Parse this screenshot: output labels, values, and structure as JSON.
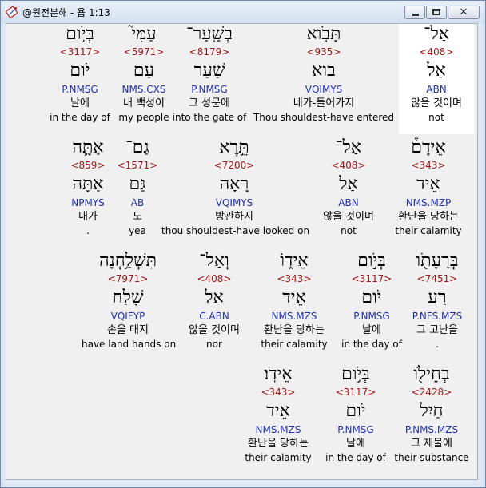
{
  "window": {
    "title": "@원전분해 - 욥 1:13",
    "icon": "bible-book-icon",
    "controls": {
      "minimize": "minimize-icon",
      "maximize": "maximize-icon",
      "close_glyph": "✕"
    }
  },
  "colors": {
    "strong": "#a01818",
    "parse": "#1f2fb0",
    "selected_bg": "#ffffff",
    "client_bg": "#f0f0f0"
  },
  "rows": [
    [
      {
        "hebrew": "אַל־",
        "strong": "<408>",
        "lemma": "אַל",
        "parse": "ABN",
        "korean": "않을 것이며",
        "english": "not",
        "selected": true
      },
      {
        "hebrew": "תָּבֹ֣וא",
        "strong": "<935>",
        "lemma": "בוא",
        "parse": "VQIMYS",
        "korean": "네가-들어가지",
        "english": "Thou shouldest-have entered"
      },
      {
        "hebrew": "בְשַֽׁעַר־",
        "strong": "<8179>",
        "lemma": "שַׁעַר",
        "parse": "P.NMSG",
        "korean": "그 성문에",
        "english": "into the gate of"
      },
      {
        "hebrew": "עַמִּי֮",
        "strong": "<5971>",
        "lemma": "עַם",
        "parse": "NMS.CXS",
        "korean": "내 백성이",
        "english": "my people"
      },
      {
        "hebrew": "בְּיֹ֣ום",
        "strong": "<3117>",
        "lemma": "יֹום",
        "parse": "P.NMSG",
        "korean": "날에",
        "english": "in the day of"
      }
    ],
    [
      {
        "hebrew": "אֵידָם֒",
        "strong": "<343>",
        "lemma": "אֵיד",
        "parse": "NMS.MZP",
        "korean": "환난을 당하는",
        "english": "their calamity"
      },
      {
        "hebrew": "אַל־",
        "strong": "<408>",
        "lemma": "אַל",
        "parse": "ABN",
        "korean": "않을 것이며",
        "english": "not"
      },
      {
        "hebrew": "תֵּ֣רֶא",
        "strong": "<7200>",
        "lemma": "רָאָה",
        "parse": "VQIMYS",
        "korean": "방관하지",
        "english": "thou shouldest-have looked on"
      },
      {
        "hebrew": "גַם־",
        "strong": "<1571>",
        "lemma": "גַּם",
        "parse": "AB",
        "korean": "도",
        "english": "yea"
      },
      {
        "hebrew": "אַתָּ֛ה",
        "strong": "<859>",
        "lemma": "אַתָּה",
        "parse": "NPMYS",
        "korean": "내가",
        "english": "."
      }
    ],
    [
      {
        "hebrew": "בְּרָעָתֹ֖ו",
        "strong": "<7451>",
        "lemma": "רַע",
        "parse": "P.NFS.MZS",
        "korean": "그 고난을",
        "english": "."
      },
      {
        "hebrew": "בְּיֹ֣ום",
        "strong": "<3117>",
        "lemma": "יֹום",
        "parse": "P.NMSG",
        "korean": "날에",
        "english": "in the day of"
      },
      {
        "hebrew": "אֵיד֑וֹ",
        "strong": "<343>",
        "lemma": "אֵיד",
        "parse": "NMS.MZS",
        "korean": "환난을 당하는",
        "english": "their calamity"
      },
      {
        "hebrew": "וְאַל־",
        "strong": "<408>",
        "lemma": "אַל",
        "parse": "C.ABN",
        "korean": "않을 것이며",
        "english": "nor"
      },
      {
        "hebrew": "תִּשְׁלַ֥חְנָה",
        "strong": "<7971>",
        "lemma": "שָׁלַח",
        "parse": "VQIFYP",
        "korean": "손을 대지",
        "english": "have land hands on"
      }
    ],
    [
      {
        "hebrew": "בְחֵילֹ֖ו",
        "strong": "<2428>",
        "lemma": "חַיִל",
        "parse": "P.NMS.MZS",
        "korean": "그 재물에",
        "english": "their substance"
      },
      {
        "hebrew": "בְּיֹ֥ום",
        "strong": "<3117>",
        "lemma": "יֹום",
        "parse": "P.NMSG",
        "korean": "날에",
        "english": "in the day of"
      },
      {
        "hebrew": "אֵידֹֽו׃",
        "strong": "<343>",
        "lemma": "אֵיד",
        "parse": "NMS.MZS",
        "korean": "환난을 당하는",
        "english": "their calamity"
      }
    ]
  ]
}
